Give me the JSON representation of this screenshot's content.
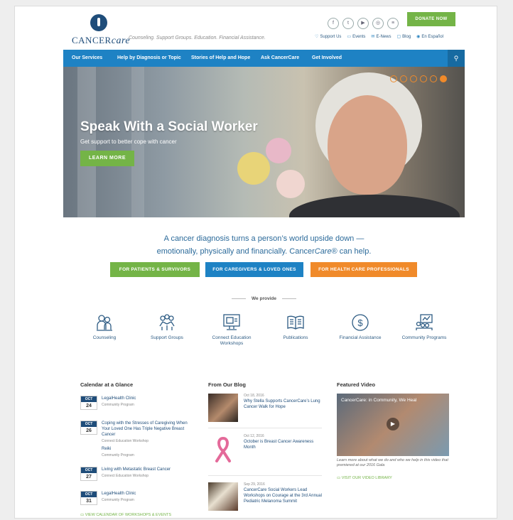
{
  "header": {
    "logo_main": "CANCER",
    "logo_italic": "care",
    "tagline": "Counseling. Support Groups. Education. Financial Assistance.",
    "socials": [
      {
        "icon": "facebook-icon",
        "glyph": "f"
      },
      {
        "icon": "twitter-icon",
        "glyph": "t"
      },
      {
        "icon": "youtube-icon",
        "glyph": "▶"
      },
      {
        "icon": "instagram-icon",
        "glyph": "◎"
      },
      {
        "icon": "email-icon",
        "glyph": "≡"
      }
    ],
    "donate_label": "DONATE NOW",
    "utility": [
      {
        "icon": "heart-icon",
        "glyph": "♡",
        "label": "Support Us"
      },
      {
        "icon": "calendar-icon",
        "glyph": "▭",
        "label": "Events"
      },
      {
        "icon": "envelope-icon",
        "glyph": "✉",
        "label": "E-News"
      },
      {
        "icon": "chat-icon",
        "glyph": "▢",
        "label": "Blog"
      },
      {
        "icon": "globe-icon",
        "glyph": "◉",
        "label": "En Español"
      }
    ]
  },
  "nav": {
    "items": [
      "Our Services",
      "Help by Diagnosis or Topic",
      "Stories of Help and Hope",
      "Ask CancerCare",
      "Get Involved"
    ],
    "search_icon": "search-icon"
  },
  "hero": {
    "title": "Speak With a Social Worker",
    "subtitle": "Get support to better cope with cancer",
    "button": "LEARN MORE",
    "slides": 6,
    "active_slide": 6
  },
  "intro": {
    "line1": "A cancer diagnosis turns a person’s world upside down —",
    "line2_a": "emotionally, physically and financially. Cancer",
    "line2_b": "Care",
    "line2_c": "® can help."
  },
  "audience_buttons": [
    {
      "label": "FOR PATIENTS & SURVIVORS",
      "color": "#74b447"
    },
    {
      "label": "FOR CAREGIVERS & LOVED ONES",
      "color": "#1e82c4"
    },
    {
      "label": "FOR HEALTH CARE PROFESSIONALS",
      "color": "#f08a2a"
    }
  ],
  "provide_heading": "We provide",
  "services": [
    {
      "label": "Counseling",
      "icon": "counseling-icon"
    },
    {
      "label": "Support Groups",
      "icon": "support-groups-icon"
    },
    {
      "label": "Connect Education Workshops",
      "icon": "workshops-icon"
    },
    {
      "label": "Publications",
      "icon": "publications-icon"
    },
    {
      "label": "Financial Assistance",
      "icon": "financial-icon"
    },
    {
      "label": "Community Programs",
      "icon": "community-icon"
    }
  ],
  "calendar": {
    "title": "Calendar at a Glance",
    "events": [
      {
        "month": "OCT",
        "day": "24",
        "title": "LegalHealth Clinic",
        "type": "Community Program"
      },
      {
        "month": "OCT",
        "day": "26",
        "title": "Coping with the Stresses of Caregiving When Your Loved One Has Triple Negative Breast Cancer",
        "type": "Connect Education Workshop",
        "extra_title": "Reiki",
        "extra_type": "Community Program"
      },
      {
        "month": "OCT",
        "day": "27",
        "title": "Living with Metastatic Breast Cancer",
        "type": "Connect Education Workshop"
      },
      {
        "month": "OCT",
        "day": "31",
        "title": "LegalHealth Clinic",
        "type": "Community Program"
      }
    ],
    "link": "VIEW CALENDAR OF WORKSHOPS & EVENTS"
  },
  "blog": {
    "title": "From Our Blog",
    "posts": [
      {
        "date": "Oct 18, 2016",
        "title": "Why Stella Supports CancerCare’s Lung Cancer Walk for Hope"
      },
      {
        "date": "Oct 12, 2016",
        "title": "October is Breast Cancer Awareness Month"
      },
      {
        "date": "Sep 29, 2016",
        "title": "CancerCare Social Workers Lead Workshops on Courage at the 3rd Annual Pediatric Melanoma Summit"
      }
    ]
  },
  "video": {
    "title": "Featured Video",
    "video_title": "CancerCare: in Community, We Heal",
    "caption": "Learn more about what we do and who we help in this video that premiered at our 2016 Gala",
    "link": "VISIT OUR VIDEO LIBRARY"
  }
}
